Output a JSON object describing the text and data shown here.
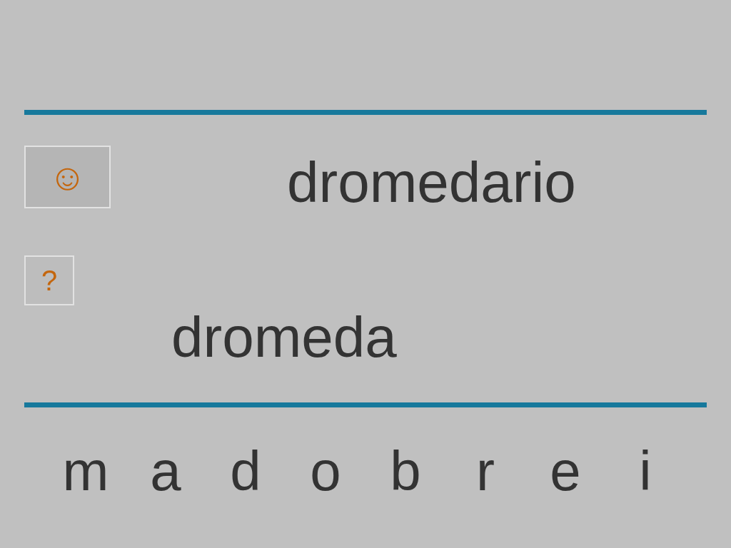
{
  "hint_button": {
    "label": "☺"
  },
  "target_word": "dromedario",
  "help_button": {
    "label": "?"
  },
  "answer": "dromeda",
  "letters": [
    {
      "label": "m"
    },
    {
      "label": "a"
    },
    {
      "label": "d"
    },
    {
      "label": "o"
    },
    {
      "label": "b"
    },
    {
      "label": "r"
    },
    {
      "label": "e"
    },
    {
      "label": "i"
    }
  ]
}
